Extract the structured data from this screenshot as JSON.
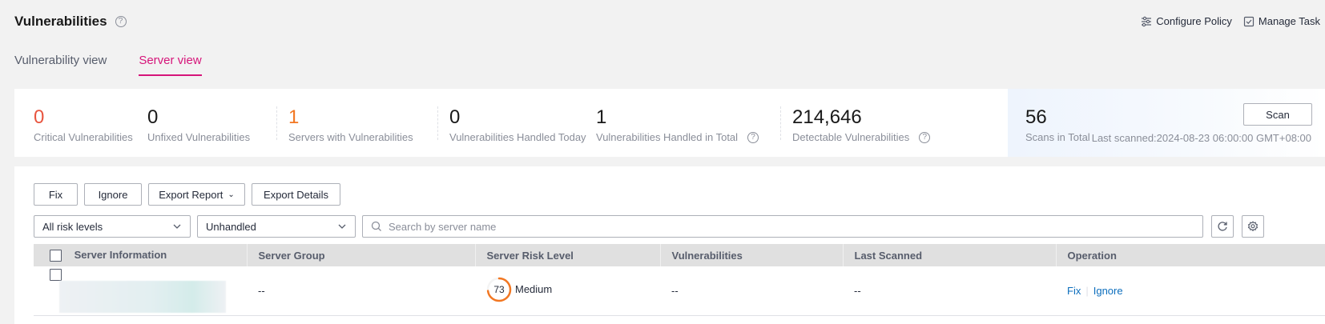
{
  "header": {
    "title": "Vulnerabilities",
    "help": "?",
    "configure_policy": "Configure Policy",
    "manage_task": "Manage Task"
  },
  "tabs": [
    {
      "label": "Vulnerability view",
      "active": false
    },
    {
      "label": "Server view",
      "active": true
    }
  ],
  "stats": {
    "critical": {
      "value": "0",
      "label": "Critical Vulnerabilities"
    },
    "unfixed": {
      "value": "0",
      "label": "Unfixed Vulnerabilities"
    },
    "servers": {
      "value": "1",
      "label": "Servers with Vulnerabilities"
    },
    "handled_today": {
      "value": "0",
      "label": "Vulnerabilities Handled Today"
    },
    "handled_total": {
      "value": "1",
      "label": "Vulnerabilities Handled in Total"
    },
    "detectable": {
      "value": "214,646",
      "label": "Detectable Vulnerabilities"
    },
    "scans": {
      "value": "56",
      "label": "Scans in Total"
    },
    "scan_button": "Scan",
    "last_scanned": "Last scanned:2024-08-23 06:00:00 GMT+08:00"
  },
  "toolbar": {
    "fix": "Fix",
    "ignore": "Ignore",
    "export_report": "Export Report",
    "export_details": "Export Details"
  },
  "filters": {
    "risk_level": "All risk levels",
    "status": "Unhandled",
    "search_placeholder": "Search by server name"
  },
  "table": {
    "columns": [
      "Server Information",
      "Server Group",
      "Server Risk Level",
      "Vulnerabilities",
      "Last Scanned",
      "Operation"
    ],
    "rows": [
      {
        "server_group": "--",
        "risk_score": "73",
        "risk_fraction": 0.73,
        "risk_label": "Medium",
        "vulnerabilities": "--",
        "last_scanned": "--",
        "op_fix": "Fix",
        "op_ignore": "Ignore"
      }
    ]
  },
  "colors": {
    "accent": "#d6157a",
    "critical": "#e8553f",
    "warning": "#f27722",
    "link": "#0c6ebd",
    "risk_medium": "#f27722"
  }
}
